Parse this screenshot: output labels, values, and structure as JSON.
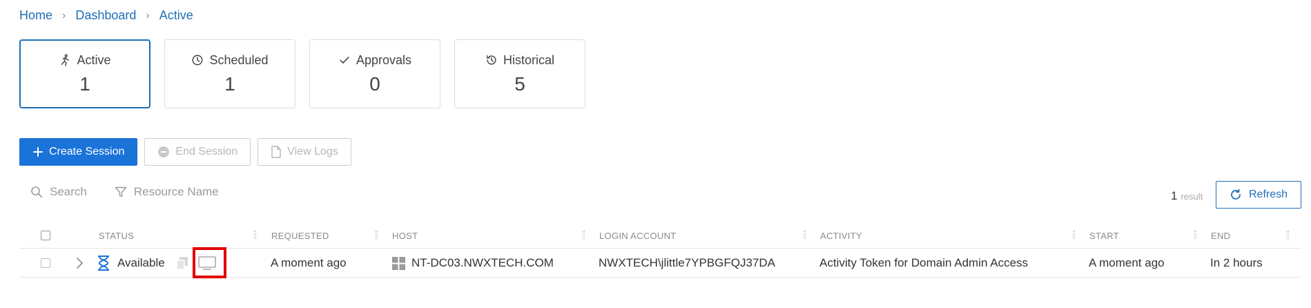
{
  "breadcrumb": {
    "items": [
      "Home",
      "Dashboard",
      "Active"
    ]
  },
  "cards": [
    {
      "label": "Active",
      "count": "1",
      "icon": "running-person-icon"
    },
    {
      "label": "Scheduled",
      "count": "1",
      "icon": "clock-icon"
    },
    {
      "label": "Approvals",
      "count": "0",
      "icon": "checkmark-icon"
    },
    {
      "label": "Historical",
      "count": "5",
      "icon": "history-icon"
    }
  ],
  "toolbar": {
    "create_label": "Create Session",
    "end_label": "End Session",
    "logs_label": "View Logs"
  },
  "filters": {
    "search": "Search",
    "resource": "Resource Name"
  },
  "results": {
    "count": "1",
    "label": "result"
  },
  "refresh_label": "Refresh",
  "table": {
    "columns": [
      "STATUS",
      "REQUESTED",
      "HOST",
      "LOGIN ACCOUNT",
      "ACTIVITY",
      "START",
      "END"
    ],
    "rows": [
      {
        "status": "Available",
        "requested": "A moment ago",
        "host": "NT-DC03.NWXTECH.COM",
        "login_account": "NWXTECH\\jlittle7YPBGFQJ37DA",
        "activity": "Activity Token for Domain Admin Access",
        "start": "A moment ago",
        "end": "In 2 hours"
      }
    ]
  },
  "colors": {
    "accent": "#1a73d9",
    "link": "#1f6fb5",
    "highlight": "#e00000"
  }
}
